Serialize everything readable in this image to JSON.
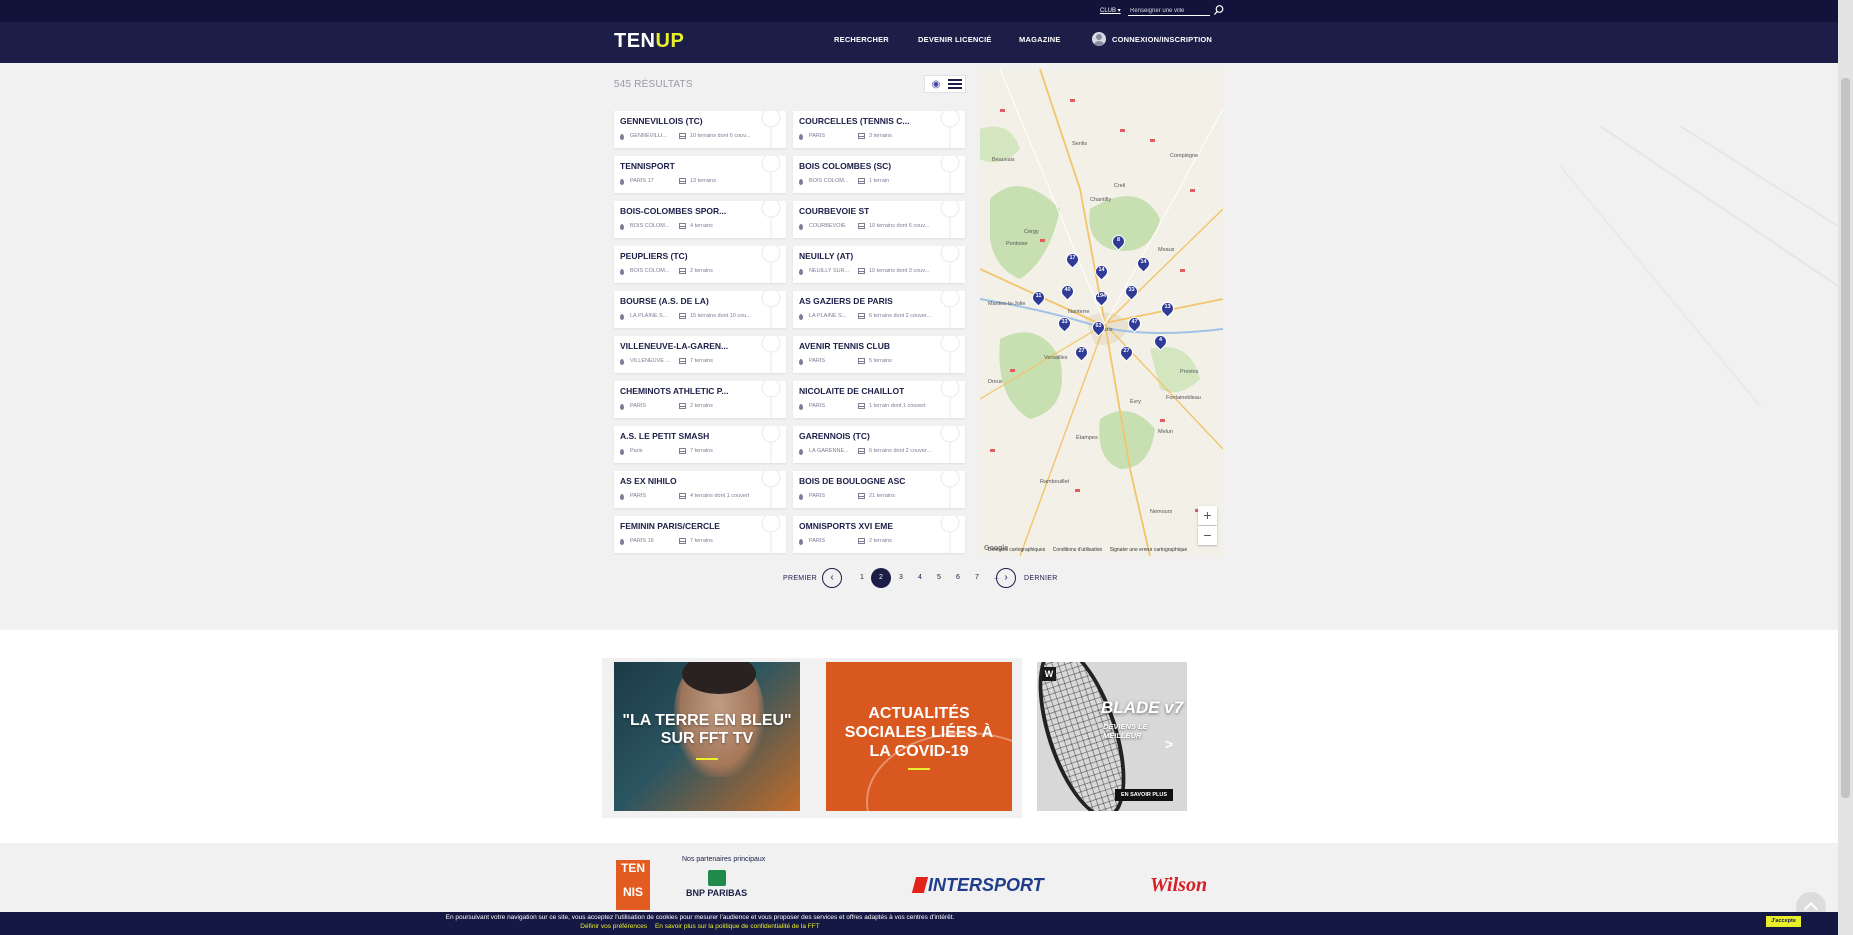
{
  "topbar": {
    "club_select": "CLUB",
    "city_placeholder": "Renseigner une ville"
  },
  "header": {
    "logo_prefix": "TEN",
    "logo_suffix": "UP",
    "nav": [
      "RECHERCHER",
      "DEVENIR LICENCIÉ",
      "MAGAZINE",
      "CONNEXION/INSCRIPTION"
    ]
  },
  "results": {
    "count_label": "545 RÉSULTATS"
  },
  "clubs": [
    {
      "name": "GENNEVILLOIS (TC)",
      "city": "GENNEVILLI...",
      "courts": "10 terrains dont 6 couv..."
    },
    {
      "name": "COURCELLES (TENNIS C...",
      "city": "PARIS",
      "courts": "3 terrains"
    },
    {
      "name": "TENNISPORT",
      "city": "PARIS 17",
      "courts": "13 terrains"
    },
    {
      "name": "BOIS COLOMBES (SC)",
      "city": "BOIS COLOM...",
      "courts": "1 terrain"
    },
    {
      "name": "BOIS-COLOMBES SPOR...",
      "city": "BOIS COLOM...",
      "courts": "4 terrains"
    },
    {
      "name": "COURBEVOIE ST",
      "city": "COURBEVOIE",
      "courts": "10 terrains dont 6 couv..."
    },
    {
      "name": "PEUPLIERS (TC)",
      "city": "BOIS COLOM...",
      "courts": "2 terrains"
    },
    {
      "name": "NEUILLY (AT)",
      "city": "NEUILLY SUR...",
      "courts": "10 terrains dont 3 couv..."
    },
    {
      "name": "BOURSE (A.S. DE LA)",
      "city": "LA PLAINE S...",
      "courts": "15 terrains dont 10 cou..."
    },
    {
      "name": "AS GAZIERS DE PARIS",
      "city": "LA PLAINE S...",
      "courts": "6 terrains dont 2 couver..."
    },
    {
      "name": "VILLENEUVE-LA-GAREN...",
      "city": "VILLENEUVE ...",
      "courts": "7 terrains"
    },
    {
      "name": "AVENIR TENNIS CLUB",
      "city": "PARIS",
      "courts": "5 terrains"
    },
    {
      "name": "CHEMINOTS ATHLETIC P...",
      "city": "PARIS",
      "courts": "2 terrains"
    },
    {
      "name": "NICOLAITE DE CHAILLOT",
      "city": "PARIS",
      "courts": "1 terrain dont 1 couvert"
    },
    {
      "name": "A.S. LE PETIT SMASH",
      "city": "Paris",
      "courts": "7 terrains"
    },
    {
      "name": "GARENNOIS (TC)",
      "city": "LA GARENNE...",
      "courts": "6 terrains dont 2 couver..."
    },
    {
      "name": "AS EX NIHILO",
      "city": "PARIS",
      "courts": "4 terrains dont 1 couvert"
    },
    {
      "name": "BOIS DE BOULOGNE ASC",
      "city": "PARIS",
      "courts": "21 terrains"
    },
    {
      "name": "FEMININ PARIS/CERCLE",
      "city": "PARIS 16",
      "courts": "7 terrains"
    },
    {
      "name": "OMNISPORTS XVI EME",
      "city": "PARIS",
      "courts": "2 terrains"
    }
  ],
  "map": {
    "markers": [
      "8",
      "17",
      "14",
      "14",
      "40",
      "194",
      "33",
      "11",
      "13",
      "33",
      "63",
      "47",
      "27",
      "27",
      "4"
    ],
    "place_labels": [
      "Beauvais",
      "Senlis",
      "Creil",
      "Chantilly",
      "Cergy",
      "Pontoise",
      "Paris",
      "Nanterre",
      "Versailles",
      "Meaux",
      "Évry",
      "Étampes",
      "Melun",
      "Rambouillet",
      "Mantes-la-Jolie",
      "Compiègne",
      "Dreux",
      "Provins",
      "Nemours",
      "Fontainebleau"
    ],
    "zoom_in": "+",
    "zoom_out": "−",
    "attribution": [
      "Données cartographiques",
      "Conditions d'utilisation",
      "Signaler une erreur cartographique"
    ],
    "google_logo": "Google"
  },
  "pagination": {
    "first": "PREMIER",
    "last": "DERNIER",
    "prev": "‹",
    "next": "›",
    "pages": [
      "1",
      "2",
      "3",
      "4",
      "5",
      "6",
      "7",
      "..."
    ],
    "current": "2"
  },
  "banners": [
    {
      "text": "\"LA TERRE EN BLEU\" SUR FFT TV"
    },
    {
      "text": "ACTUALITÉS SOCIALES LIÉES À LA COVID-19"
    },
    {
      "logo": "W",
      "title": "BLADE v7",
      "subtitle": "DEVIENS LE MEILLEUR",
      "chevron": ">",
      "button": "EN SAVOIR PLUS"
    }
  ],
  "partners": {
    "title": "Nos partenaires principaux",
    "tennis_logo_line1": "TEN",
    "tennis_logo_line2": "NIS",
    "bnp": "BNP PARIBAS",
    "intersport": "INTERSPORT",
    "wilson": "Wilson"
  },
  "cookie": {
    "text": "En poursuivant votre navigation sur ce site, vous acceptez l'utilisation de cookies pour mesurer l'audience et vous proposer des services et offres adaptés à vos centres d'intérêt.",
    "link_preferences": "Définir vos préférences",
    "link_policy": "En savoir plus sur la politique de confidentialité de la FFT",
    "accept": "J'accepte"
  },
  "colors": {
    "navy": "#1c1e48",
    "accent_yellow": "#e8ef2a",
    "marker_blue": "#2f3b97",
    "banner_orange": "#d9581f"
  }
}
